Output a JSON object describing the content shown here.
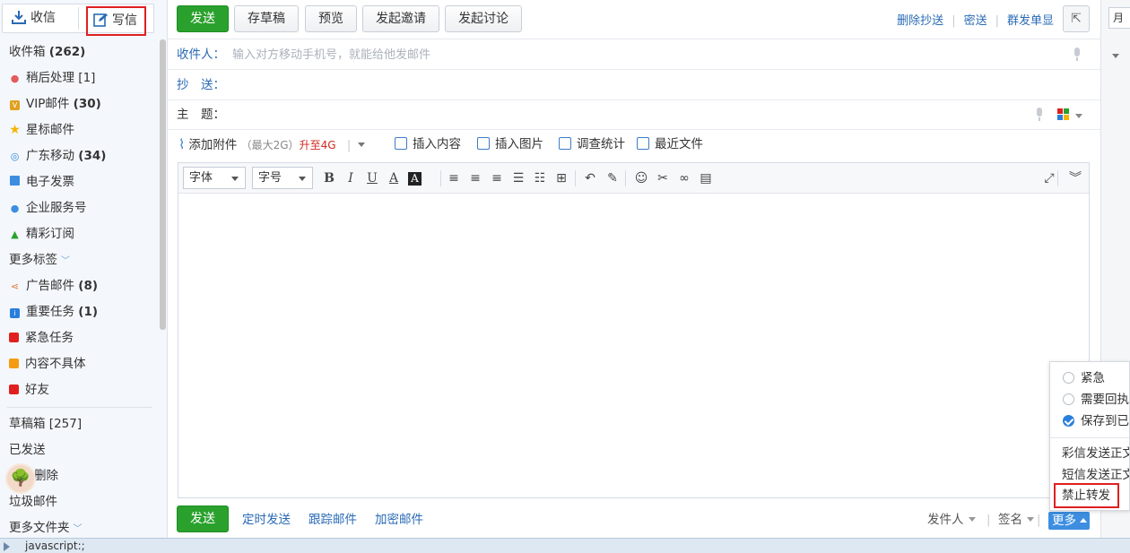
{
  "sidebar": {
    "inbox_btn": "收信",
    "compose_btn": "写信",
    "items": [
      {
        "label": "收件箱",
        "count": "(262)",
        "color": "",
        "icon": "none"
      },
      {
        "label": "稍后处理",
        "count": "[1]",
        "color": "#e35b5b",
        "icon": "clock-icon"
      },
      {
        "label": "VIP邮件",
        "count": "(30)",
        "color": "#e0a020",
        "icon": "vip-icon"
      },
      {
        "label": "星标邮件",
        "count": "",
        "color": "#f5b400",
        "icon": "star-icon"
      },
      {
        "label": "广东移动",
        "count": "(34)",
        "color": "#2a8ad8",
        "icon": "mobile-logo-icon"
      },
      {
        "label": "电子发票",
        "count": "",
        "color": "#3d8ee0",
        "icon": "invoice-icon"
      },
      {
        "label": "企业服务号",
        "count": "",
        "color": "#3d8ee0",
        "icon": "person-icon"
      },
      {
        "label": "精彩订阅",
        "count": "",
        "color": "#2aa12c",
        "icon": "subscribe-icon"
      }
    ],
    "more_tags": "更多标签",
    "tags": [
      {
        "label": "广告邮件",
        "count": "(8)",
        "color": "#e57a3b",
        "icon": "share-icon"
      },
      {
        "label": "重要任务",
        "count": "(1)",
        "color": "#2a7fdc",
        "icon": "info-icon"
      },
      {
        "label": "紧急任务",
        "count": "",
        "color": "#e02020",
        "icon": "square"
      },
      {
        "label": "内容不具体",
        "count": "",
        "color": "#f39c12",
        "icon": "square"
      },
      {
        "label": "好友",
        "count": "",
        "color": "#e02020",
        "icon": "square"
      }
    ],
    "folders": [
      {
        "label": "草稿箱",
        "count": "[257]"
      },
      {
        "label": "已发送",
        "count": ""
      },
      {
        "label": "删除",
        "count": ""
      },
      {
        "label": "垃圾邮件",
        "count": ""
      }
    ],
    "more_folders": "更多文件夹"
  },
  "toolbar": {
    "send": "发送",
    "save_draft": "存草稿",
    "preview": "预览",
    "invite": "发起邀请",
    "discuss": "发起讨论",
    "remove_cc": "删除抄送",
    "bcc": "密送",
    "group_single": "群发单显"
  },
  "compose": {
    "to_label": "收件人：",
    "to_placeholder": "输入对方移动手机号，就能给他发邮件",
    "cc_label": "抄　送：",
    "subject_label": "主　题："
  },
  "attach": {
    "add": "添加附件",
    "max": "（最大2G）",
    "upgrade": "升至4G",
    "insert_content": "插入内容",
    "insert_image": "插入图片",
    "survey": "调查统计",
    "recent_files": "最近文件"
  },
  "editor": {
    "font": "字体",
    "size": "字号"
  },
  "bottom": {
    "send": "发送",
    "schedule": "定时发送",
    "track": "跟踪邮件",
    "encrypt": "加密邮件",
    "sender": "发件人",
    "signature": "签名",
    "more": "更多"
  },
  "popup": {
    "urgent": "紧急",
    "receipt": "需要回执",
    "save_sent": "保存到已发送",
    "mms_send": "彩信发送正文",
    "sms_send": "短信发送正文",
    "forbid_forward": "禁止转发"
  },
  "right_panel": {
    "month_label": "月"
  },
  "statusbar": {
    "text": "javascript:;"
  }
}
